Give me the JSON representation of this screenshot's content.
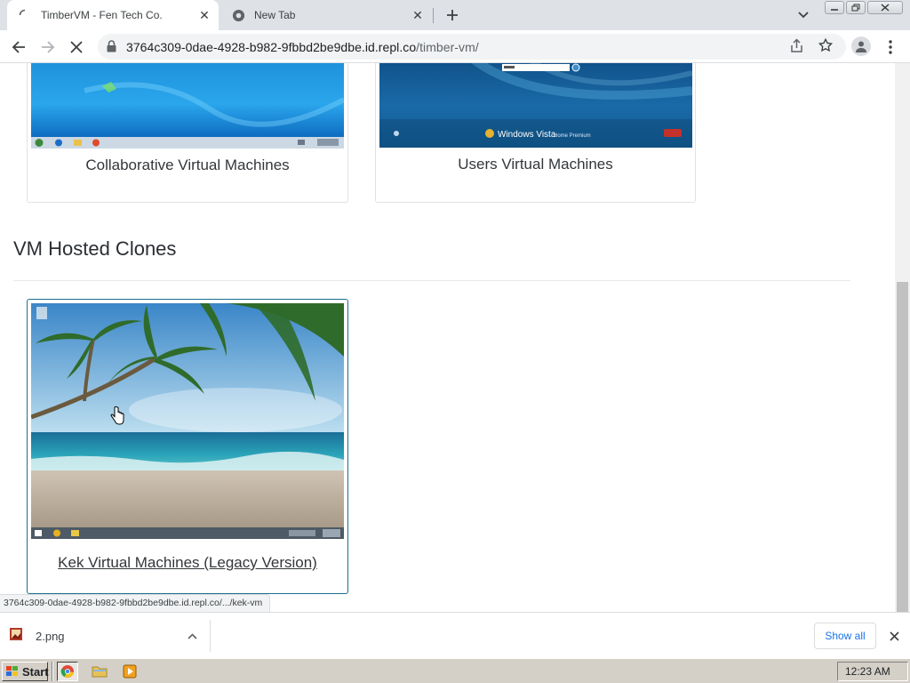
{
  "browser": {
    "tabs": [
      {
        "title": "TimberVM - Fen Tech Co.",
        "active": true,
        "loading": true
      },
      {
        "title": "New Tab",
        "active": false
      }
    ],
    "url": {
      "host": "3764c309-0dae-4928-b982-9fbbd2be9dbe.id.repl.co",
      "path": "/timber-vm/"
    },
    "status_url": "3764c309-0dae-4928-b982-9fbbd2be9dbe.id.repl.co/.../kek-vm"
  },
  "page": {
    "cards_top": [
      {
        "caption": "Collaborative Virtual Machines"
      },
      {
        "caption": "Users Virtual Machines",
        "thumb_text": "Windows Vista",
        "thumb_subtext": "Home Premium"
      }
    ],
    "section_title": "VM Hosted Clones",
    "clone_card": {
      "caption": "Kek Virtual Machines (Legacy Version)"
    }
  },
  "downloads": {
    "file_name": "2.png",
    "show_all_label": "Show all"
  },
  "taskbar": {
    "start_label": "Start",
    "clock": "12:23 AM"
  },
  "colors": {
    "accent": "#1a73e8",
    "tabstrip": "#dee1e6",
    "taskbar": "#d4d0c8"
  }
}
